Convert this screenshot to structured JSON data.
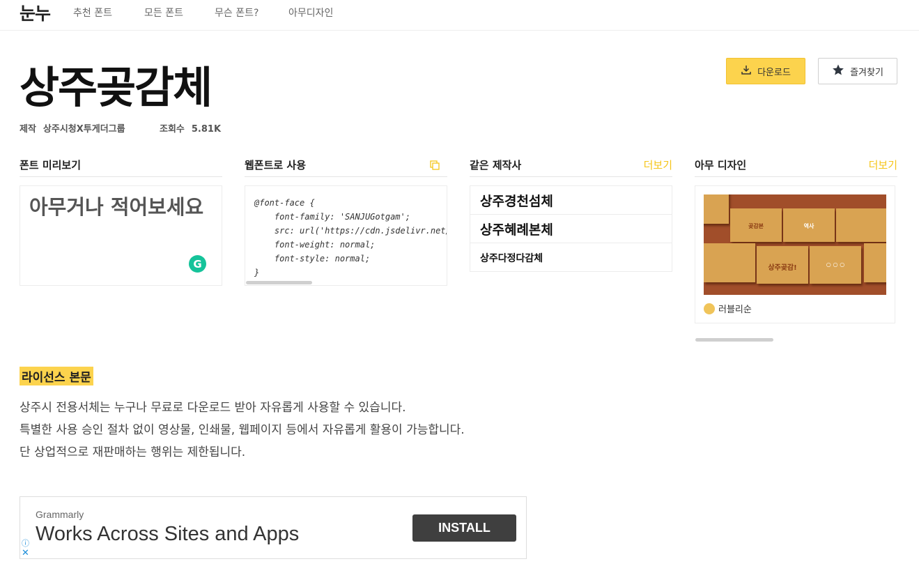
{
  "nav": {
    "logo": "눈누",
    "links": [
      "추천 폰트",
      "모든 폰트",
      "무슨 폰트?",
      "아무디자인"
    ]
  },
  "font": {
    "title": "상주곶감체",
    "maker_label": "제작",
    "maker": "상주시청X투게더그룹",
    "views_label": "조회수",
    "views": "5.81K"
  },
  "actions": {
    "download": "다운로드",
    "favorite": "즐겨찾기"
  },
  "sections": {
    "preview": {
      "title": "폰트 미리보기",
      "placeholder": "아무거나 적어보세요"
    },
    "webfont": {
      "title": "웹폰트로 사용",
      "code": "@font-face {\n    font-family: 'SANJUGotgam';\n    src: url('https://cdn.jsdelivr.net/gh/projectnoonnu/noonfonts_2112@1.0/SANJUGotgam.woff') format('woff');\n    font-weight: normal;\n    font-style: normal;\n}"
    },
    "same_maker": {
      "title": "같은 제작사",
      "more": "더보기",
      "fonts": [
        "상주경천섬체",
        "상주혜례본체",
        "상주다정다감체"
      ]
    },
    "any_design": {
      "title": "아무 디자인",
      "more": "더보기",
      "author": "러블리순",
      "thumb_labels": [
        "곶감본",
        "역사",
        "상주곶감!",
        "○ ○ ○"
      ]
    }
  },
  "license": {
    "title": "라이선스 본문",
    "lines": [
      "상주시 전용서체는 누구나 무료로 다운로드 받아 자유롭게 사용할 수 있습니다.",
      "특별한 사용 승인 절차 없이 영상물, 인쇄물, 웹페이지 등에서 자유롭게 활용이 가능합니다.",
      "단 상업적으로 재판매하는 행위는 제한됩니다."
    ]
  },
  "ad": {
    "brand": "Grammarly",
    "headline": "Works Across Sites and Apps",
    "cta": "INSTALL"
  },
  "colors": {
    "accent": "#fcd34d",
    "more_link": "#f5c518",
    "grammarly": "#15c39a"
  }
}
